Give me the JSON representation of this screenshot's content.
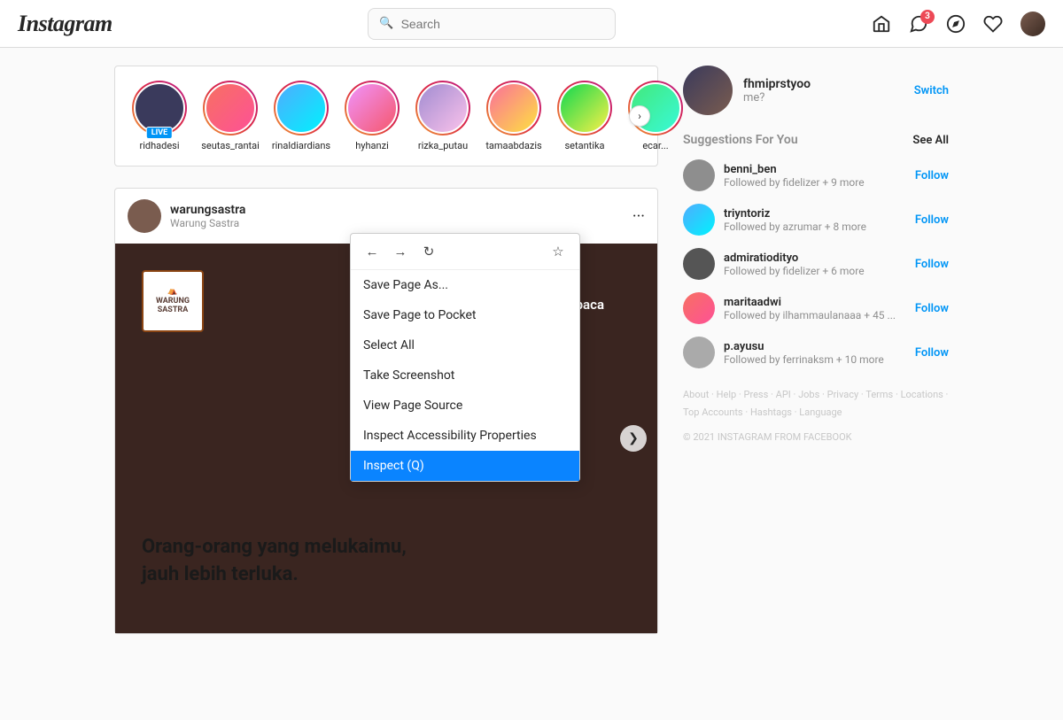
{
  "header": {
    "logo": "Instagram",
    "search_placeholder": "Search",
    "nav": {
      "home_icon": "🏠",
      "messenger_icon": "💬",
      "messenger_badge": "3",
      "explore_icon": "⊕",
      "heart_icon": "♡"
    }
  },
  "stories": {
    "items": [
      {
        "username": "ridhadesi",
        "live": true
      },
      {
        "username": "seutas_rantai",
        "live": false
      },
      {
        "username": "rinaldiardians",
        "live": false
      },
      {
        "username": "hyhanzi",
        "live": false
      },
      {
        "username": "rizka_putau",
        "live": false
      },
      {
        "username": "tamaabdazis",
        "live": false
      },
      {
        "username": "setantika",
        "live": false
      },
      {
        "username": "ecar...",
        "live": false
      }
    ],
    "next_label": "›"
  },
  "post": {
    "username": "warungsastra",
    "subtitle": "Warung Sastra",
    "logo_text": "WARUNG\nSASTRA",
    "hashtag": "#bahagia\nmembaca",
    "body_text": "Orang-orang yang melukaimu,\njauh lebih terluka.",
    "next_label": "❯"
  },
  "context_menu": {
    "back": "←",
    "forward": "→",
    "refresh": "↻",
    "bookmark": "☆",
    "items": [
      {
        "label": "Save Page As...",
        "highlighted": false
      },
      {
        "label": "Save Page to Pocket",
        "highlighted": false
      },
      {
        "label": "Select All",
        "highlighted": false
      },
      {
        "label": "Take Screenshot",
        "highlighted": false
      },
      {
        "label": "View Page Source",
        "highlighted": false
      },
      {
        "label": "Inspect Accessibility Properties",
        "highlighted": false
      },
      {
        "label": "Inspect (Q)",
        "highlighted": true
      }
    ]
  },
  "sidebar": {
    "username": "fhmiprstyoo",
    "subtext": "me?",
    "switch_label": "Switch",
    "suggestions_title": "Suggestions For You",
    "see_all_label": "See All",
    "suggestions": [
      {
        "username": "benni_ben",
        "sub": "Followed by fidelizer + 9 more",
        "follow": "Follow"
      },
      {
        "username": "triyntoriz",
        "sub": "Followed by azrumar + 8 more",
        "follow": "Follow"
      },
      {
        "username": "admiratiodityo",
        "sub": "Followed by fidelizer + 6 more",
        "follow": "Follow"
      },
      {
        "username": "maritaadwi",
        "sub": "Followed by ilhammaulanaaa + 45 ...",
        "follow": "Follow"
      },
      {
        "username": "p.ayusu",
        "sub": "Followed by ferrinaksm + 10 more",
        "follow": "Follow"
      }
    ],
    "footer_links": [
      "About",
      "Help",
      "Press",
      "API",
      "Jobs",
      "Privacy",
      "Terms",
      "Locations",
      "Top Accounts",
      "Hashtags",
      "Language"
    ],
    "copyright": "© 2021 INSTAGRAM FROM FACEBOOK"
  }
}
